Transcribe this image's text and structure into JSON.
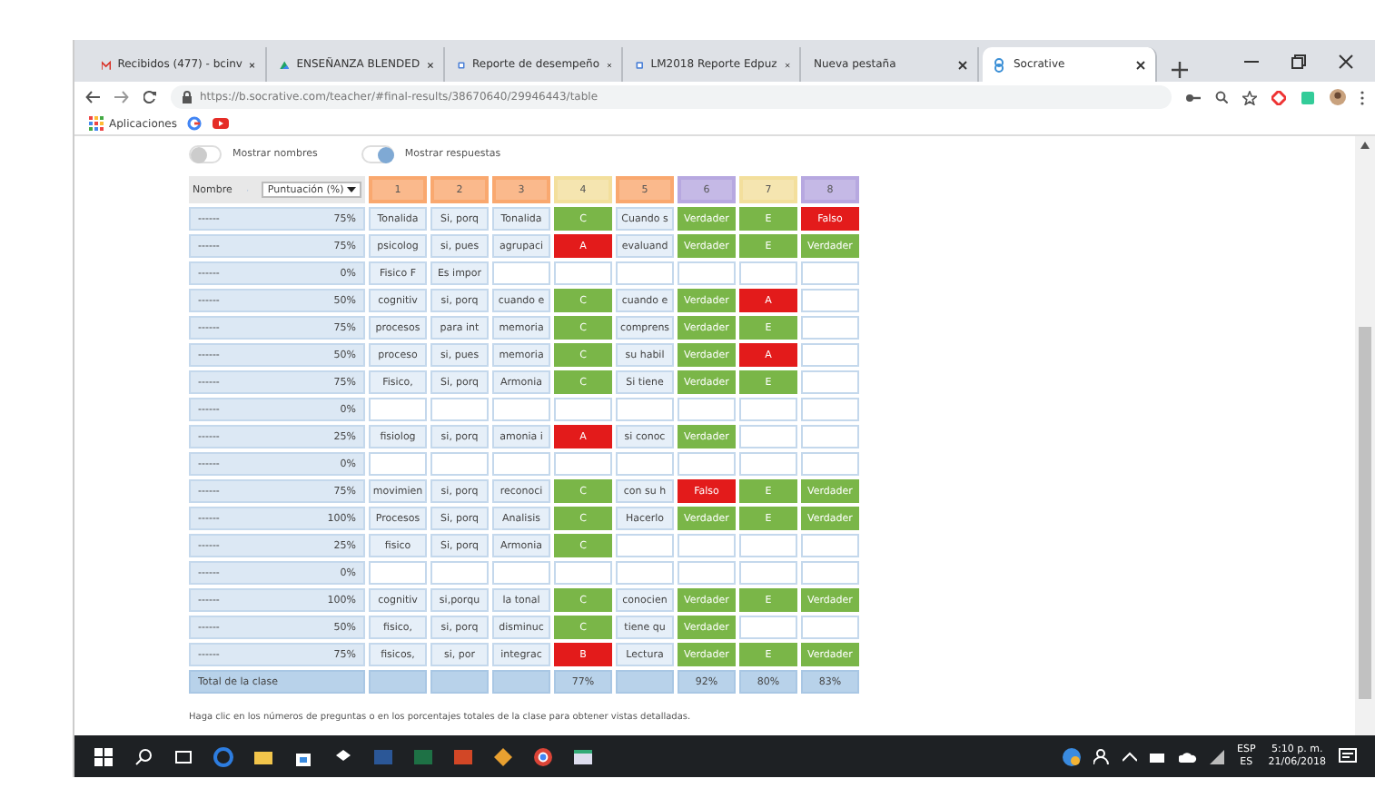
{
  "browser": {
    "tabs": [
      {
        "kind": "mail",
        "title": "Recibidos (477) - bcinv",
        "selected": false
      },
      {
        "kind": "drive",
        "title": "ENSEÑANZA BLENDED",
        "selected": false
      },
      {
        "kind": "report",
        "title": "Reporte de desempeño",
        "selected": false
      },
      {
        "kind": "report",
        "title": "LM2018 Reporte Edpuz",
        "selected": false
      },
      {
        "kind": "blank",
        "title": "Nueva pestaña",
        "selected": false
      },
      {
        "kind": "socrative",
        "title": "Socrative",
        "selected": true
      }
    ],
    "address": {
      "url": "https://b.socrative.com/teacher/#final-results/38670640/29946443/table"
    },
    "bookmarks": [
      {
        "label": "Aplicaciones"
      }
    ]
  },
  "page": {
    "toggles": [
      {
        "label": "Mostrar nombres",
        "on": false
      },
      {
        "label": "Mostrar respuestas",
        "on": true
      }
    ],
    "table": {
      "name_header": "Nombre",
      "score_header": "Puntuación (%)",
      "columns": [
        {
          "label": "1",
          "color": "#f9a86f"
        },
        {
          "label": "2",
          "color": "#f9a86f"
        },
        {
          "label": "3",
          "color": "#f9a86f"
        },
        {
          "label": "4",
          "color": "#f3df9c"
        },
        {
          "label": "5",
          "color": "#f9a86f"
        },
        {
          "label": "6",
          "color": "#b7a8e0"
        },
        {
          "label": "7",
          "color": "#f3df9c"
        },
        {
          "label": "8",
          "color": "#b7a8e0"
        }
      ],
      "rows": [
        {
          "name": "------",
          "score": "75%",
          "cells": [
            {
              "kind": "text",
              "text": "Tonalida"
            },
            {
              "kind": "text",
              "text": "Si, porq"
            },
            {
              "kind": "text",
              "text": "Tonalida"
            },
            {
              "kind": "correct",
              "text": "C"
            },
            {
              "kind": "text",
              "text": "Cuando s"
            },
            {
              "kind": "correct",
              "text": "Verdader"
            },
            {
              "kind": "correct",
              "text": "E"
            },
            {
              "kind": "incorrect",
              "text": "Falso"
            }
          ]
        },
        {
          "name": "------",
          "score": "75%",
          "cells": [
            {
              "kind": "text",
              "text": "psicolog"
            },
            {
              "kind": "text",
              "text": "si, pues"
            },
            {
              "kind": "text",
              "text": "agrupaci"
            },
            {
              "kind": "incorrect",
              "text": "A"
            },
            {
              "kind": "text",
              "text": "evaluand"
            },
            {
              "kind": "correct",
              "text": "Verdader"
            },
            {
              "kind": "correct",
              "text": "E"
            },
            {
              "kind": "correct",
              "text": "Verdader"
            }
          ]
        },
        {
          "name": "------",
          "score": "0%",
          "cells": [
            {
              "kind": "text",
              "text": "Fisico F"
            },
            {
              "kind": "text",
              "text": "Es impor"
            },
            {
              "kind": "empty"
            },
            {
              "kind": "empty"
            },
            {
              "kind": "empty"
            },
            {
              "kind": "empty"
            },
            {
              "kind": "empty"
            },
            {
              "kind": "empty"
            }
          ]
        },
        {
          "name": "------",
          "score": "50%",
          "cells": [
            {
              "kind": "text",
              "text": "cognitiv"
            },
            {
              "kind": "text",
              "text": "si, porq"
            },
            {
              "kind": "text",
              "text": "cuando e"
            },
            {
              "kind": "correct",
              "text": "C"
            },
            {
              "kind": "text",
              "text": "cuando e"
            },
            {
              "kind": "correct",
              "text": "Verdader"
            },
            {
              "kind": "incorrect",
              "text": "A"
            },
            {
              "kind": "empty"
            }
          ]
        },
        {
          "name": "------",
          "score": "75%",
          "cells": [
            {
              "kind": "text",
              "text": "procesos"
            },
            {
              "kind": "text",
              "text": "para int"
            },
            {
              "kind": "text",
              "text": "memoria"
            },
            {
              "kind": "correct",
              "text": "C"
            },
            {
              "kind": "text",
              "text": "comprens"
            },
            {
              "kind": "correct",
              "text": "Verdader"
            },
            {
              "kind": "correct",
              "text": "E"
            },
            {
              "kind": "empty"
            }
          ]
        },
        {
          "name": "------",
          "score": "50%",
          "cells": [
            {
              "kind": "text",
              "text": "proceso"
            },
            {
              "kind": "text",
              "text": "si, pues"
            },
            {
              "kind": "text",
              "text": "memoria"
            },
            {
              "kind": "correct",
              "text": "C"
            },
            {
              "kind": "text",
              "text": "su habil"
            },
            {
              "kind": "correct",
              "text": "Verdader"
            },
            {
              "kind": "incorrect",
              "text": "A"
            },
            {
              "kind": "empty"
            }
          ]
        },
        {
          "name": "------",
          "score": "75%",
          "cells": [
            {
              "kind": "text",
              "text": "Fisico,"
            },
            {
              "kind": "text",
              "text": "Si, porq"
            },
            {
              "kind": "text",
              "text": "Armonia"
            },
            {
              "kind": "correct",
              "text": "C"
            },
            {
              "kind": "text",
              "text": "Si tiene"
            },
            {
              "kind": "correct",
              "text": "Verdader"
            },
            {
              "kind": "correct",
              "text": "E"
            },
            {
              "kind": "empty"
            }
          ]
        },
        {
          "name": "------",
          "score": "0%",
          "cells": [
            {
              "kind": "empty"
            },
            {
              "kind": "empty"
            },
            {
              "kind": "empty"
            },
            {
              "kind": "empty"
            },
            {
              "kind": "empty"
            },
            {
              "kind": "empty"
            },
            {
              "kind": "empty"
            },
            {
              "kind": "empty"
            }
          ]
        },
        {
          "name": "------",
          "score": "25%",
          "cells": [
            {
              "kind": "text",
              "text": "fisiolog"
            },
            {
              "kind": "text",
              "text": "si, porq"
            },
            {
              "kind": "text",
              "text": "amonia i"
            },
            {
              "kind": "incorrect",
              "text": "A"
            },
            {
              "kind": "text",
              "text": "si conoc"
            },
            {
              "kind": "correct",
              "text": "Verdader"
            },
            {
              "kind": "empty"
            },
            {
              "kind": "empty"
            }
          ]
        },
        {
          "name": "------",
          "score": "0%",
          "cells": [
            {
              "kind": "empty"
            },
            {
              "kind": "empty"
            },
            {
              "kind": "empty"
            },
            {
              "kind": "empty"
            },
            {
              "kind": "empty"
            },
            {
              "kind": "empty"
            },
            {
              "kind": "empty"
            },
            {
              "kind": "empty"
            }
          ]
        },
        {
          "name": "------",
          "score": "75%",
          "cells": [
            {
              "kind": "text",
              "text": "movimien"
            },
            {
              "kind": "text",
              "text": "si, porq"
            },
            {
              "kind": "text",
              "text": "reconoci"
            },
            {
              "kind": "correct",
              "text": "C"
            },
            {
              "kind": "text",
              "text": "con su h"
            },
            {
              "kind": "incorrect",
              "text": "Falso"
            },
            {
              "kind": "correct",
              "text": "E"
            },
            {
              "kind": "correct",
              "text": "Verdader"
            }
          ]
        },
        {
          "name": "------",
          "score": "100%",
          "cells": [
            {
              "kind": "text",
              "text": "Procesos"
            },
            {
              "kind": "text",
              "text": "Si, porq"
            },
            {
              "kind": "text",
              "text": "Analisis"
            },
            {
              "kind": "correct",
              "text": "C"
            },
            {
              "kind": "text",
              "text": "Hacerlo"
            },
            {
              "kind": "correct",
              "text": "Verdader"
            },
            {
              "kind": "correct",
              "text": "E"
            },
            {
              "kind": "correct",
              "text": "Verdader"
            }
          ]
        },
        {
          "name": "------",
          "score": "25%",
          "cells": [
            {
              "kind": "text",
              "text": "fisico"
            },
            {
              "kind": "text",
              "text": "Si, porq"
            },
            {
              "kind": "text",
              "text": "Armonia"
            },
            {
              "kind": "correct",
              "text": "C"
            },
            {
              "kind": "empty"
            },
            {
              "kind": "empty"
            },
            {
              "kind": "empty"
            },
            {
              "kind": "empty"
            }
          ]
        },
        {
          "name": "------",
          "score": "0%",
          "cells": [
            {
              "kind": "empty"
            },
            {
              "kind": "empty"
            },
            {
              "kind": "empty"
            },
            {
              "kind": "empty"
            },
            {
              "kind": "empty"
            },
            {
              "kind": "empty"
            },
            {
              "kind": "empty"
            },
            {
              "kind": "empty"
            }
          ]
        },
        {
          "name": "------",
          "score": "100%",
          "cells": [
            {
              "kind": "text",
              "text": "cognitiv"
            },
            {
              "kind": "text",
              "text": "si,porqu"
            },
            {
              "kind": "text",
              "text": "la tonal"
            },
            {
              "kind": "correct",
              "text": "C"
            },
            {
              "kind": "text",
              "text": "conocien"
            },
            {
              "kind": "correct",
              "text": "Verdader"
            },
            {
              "kind": "correct",
              "text": "E"
            },
            {
              "kind": "correct",
              "text": "Verdader"
            }
          ]
        },
        {
          "name": "------",
          "score": "50%",
          "cells": [
            {
              "kind": "text",
              "text": "fisico,"
            },
            {
              "kind": "text",
              "text": "si, porq"
            },
            {
              "kind": "text",
              "text": "disminuc"
            },
            {
              "kind": "correct",
              "text": "C"
            },
            {
              "kind": "text",
              "text": "tiene qu"
            },
            {
              "kind": "correct",
              "text": "Verdader"
            },
            {
              "kind": "empty"
            },
            {
              "kind": "empty"
            }
          ]
        },
        {
          "name": "------",
          "score": "75%",
          "cells": [
            {
              "kind": "text",
              "text": "fisicos,"
            },
            {
              "kind": "text",
              "text": "si, por"
            },
            {
              "kind": "text",
              "text": "integrac"
            },
            {
              "kind": "incorrect",
              "text": "B"
            },
            {
              "kind": "text",
              "text": "Lectura"
            },
            {
              "kind": "correct",
              "text": "Verdader"
            },
            {
              "kind": "correct",
              "text": "E"
            },
            {
              "kind": "correct",
              "text": "Verdader"
            }
          ]
        }
      ],
      "total": {
        "label": "Total de la clase",
        "cells": [
          {
            "kind": "empty"
          },
          {
            "kind": "empty"
          },
          {
            "kind": "empty"
          },
          {
            "kind": "total",
            "text": "77%"
          },
          {
            "kind": "empty"
          },
          {
            "kind": "total",
            "text": "92%"
          },
          {
            "kind": "total",
            "text": "80%"
          },
          {
            "kind": "total",
            "text": "83%"
          }
        ]
      }
    },
    "note": "Haga clic en los números de preguntas o en los porcentajes totales de la clase para obtener vistas detalladas."
  },
  "taskbar": {
    "language": "ESP",
    "layout": "ES",
    "time": "5:10 p. m.",
    "date": "21/06/2018"
  }
}
